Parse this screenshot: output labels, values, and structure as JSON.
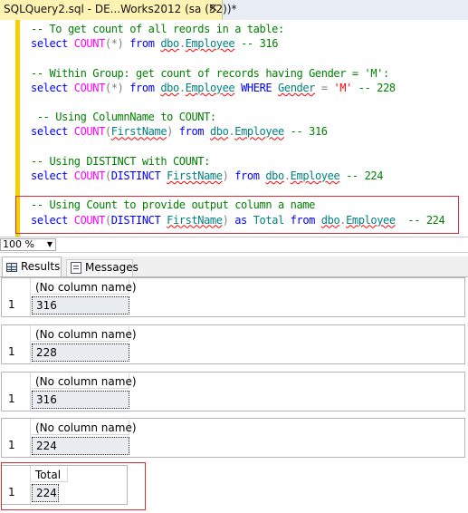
{
  "tab": {
    "title": "SQLQuery2.sql - DE...Works2012 (sa (52))*",
    "close": "✕"
  },
  "editor": {
    "lines": [
      {
        "parts": [
          [
            "cmt",
            "-- To get count of all reords in a table:"
          ]
        ]
      },
      {
        "parts": [
          [
            "kw",
            "select "
          ],
          [
            "fn",
            "COUNT"
          ],
          [
            "op",
            "(*)"
          ],
          [
            "kw",
            " from "
          ],
          [
            "obj sq",
            "dbo"
          ],
          [
            "op",
            "."
          ],
          [
            "obj sq",
            "Employee"
          ],
          [
            "cmt",
            " -- 316"
          ]
        ]
      },
      {
        "parts": []
      },
      {
        "parts": [
          [
            "cmt",
            "-- Within Group: get count of records having Gender = 'M':"
          ]
        ]
      },
      {
        "parts": [
          [
            "kw",
            "select "
          ],
          [
            "fn",
            "COUNT"
          ],
          [
            "op",
            "(*)"
          ],
          [
            "kw",
            " from "
          ],
          [
            "obj sq",
            "dbo"
          ],
          [
            "op",
            "."
          ],
          [
            "obj sq",
            "Employee"
          ],
          [
            "kw",
            " WHERE "
          ],
          [
            "obj sq",
            "Gender"
          ],
          [
            "op",
            " = "
          ],
          [
            "str",
            "'M'"
          ],
          [
            "cmt",
            " -- 228"
          ]
        ]
      },
      {
        "parts": []
      },
      {
        "parts": [
          [
            "cmt",
            " -- Using ColumnName to COUNT:"
          ]
        ]
      },
      {
        "parts": [
          [
            "kw",
            "select "
          ],
          [
            "fn",
            "COUNT"
          ],
          [
            "op",
            "("
          ],
          [
            "obj sq",
            "FirstName"
          ],
          [
            "op",
            ")"
          ],
          [
            "kw",
            " from "
          ],
          [
            "obj sq",
            "dbo"
          ],
          [
            "op",
            "."
          ],
          [
            "obj sq",
            "Employee"
          ],
          [
            "cmt",
            " -- 316"
          ]
        ]
      },
      {
        "parts": []
      },
      {
        "parts": [
          [
            "cmt",
            "-- Using DISTINCT with COUNT:"
          ]
        ]
      },
      {
        "parts": [
          [
            "kw",
            "select "
          ],
          [
            "fn",
            "COUNT"
          ],
          [
            "op",
            "("
          ],
          [
            "kw",
            "DISTINCT "
          ],
          [
            "obj sq",
            "FirstName"
          ],
          [
            "op",
            ")"
          ],
          [
            "kw",
            " from "
          ],
          [
            "obj sq",
            "dbo"
          ],
          [
            "op",
            "."
          ],
          [
            "obj sq",
            "Employee"
          ],
          [
            "cmt",
            " -- 224"
          ]
        ]
      },
      {
        "parts": []
      },
      {
        "parts": [
          [
            "cmt",
            "-- Using Count to provide output column a name"
          ]
        ]
      },
      {
        "parts": [
          [
            "kw",
            "select "
          ],
          [
            "fn",
            "COUNT"
          ],
          [
            "op",
            "("
          ],
          [
            "kw",
            "DISTINCT "
          ],
          [
            "obj sq",
            "FirstName"
          ],
          [
            "op",
            ")"
          ],
          [
            "kw",
            " as "
          ],
          [
            "obj",
            "Total"
          ],
          [
            "kw",
            " from "
          ],
          [
            "obj sq",
            "dbo"
          ],
          [
            "op",
            "."
          ],
          [
            "obj sq",
            "Employee"
          ],
          [
            "cmt",
            "  -- 224"
          ]
        ]
      }
    ]
  },
  "zoom": {
    "value": "100 %"
  },
  "results_tabs": {
    "results": "Results",
    "messages": "Messages"
  },
  "results": [
    {
      "row": "1",
      "header": "(No column name)",
      "value": "316"
    },
    {
      "row": "1",
      "header": "(No column name)",
      "value": "228"
    },
    {
      "row": "1",
      "header": "(No column name)",
      "value": "316"
    },
    {
      "row": "1",
      "header": "(No column name)",
      "value": "224"
    },
    {
      "row": "1",
      "header": "Total",
      "value": "224"
    }
  ],
  "colors": {
    "comment": "#008000",
    "keyword": "#0000ff",
    "function": "#ff00ff",
    "object": "#008080",
    "string": "#ff0000",
    "highlight_box": "#d3303a"
  }
}
